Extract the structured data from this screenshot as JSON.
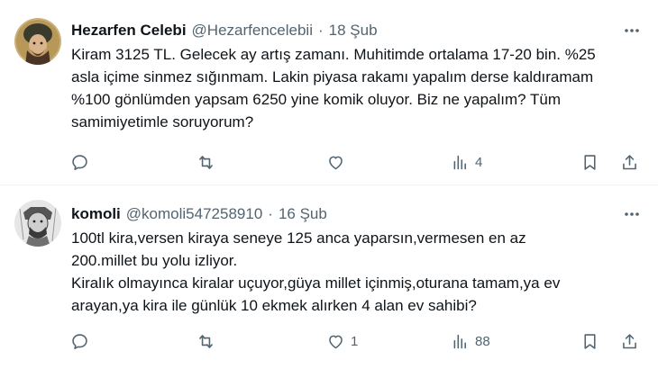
{
  "tweets": [
    {
      "author_name": "Hezarfen Celebi",
      "handle": "@Hezarfencelebii",
      "separator": "·",
      "date": "18 Şub",
      "text_lines": [
        "Kiram 3125 TL. Gelecek ay artış zamanı. Muhitimde ortalama 17-20 bin. %25",
        "asla içime sinmez sığınmam. Lakin piyasa rakamı yapalım derse kaldıramam",
        "%100 gönlümden yapsam 6250 yine komik oluyor. Biz ne yapalım? Tüm",
        "samimiyetimle soruyorum?"
      ],
      "actions": {
        "replies": "",
        "retweets": "",
        "likes": "",
        "views": "4"
      }
    },
    {
      "author_name": "komoli",
      "handle": "@komoli547258910",
      "separator": "·",
      "date": "16 Şub",
      "text_lines": [
        "100tl kira,versen kiraya seneye 125 anca yaparsın,vermesen en az",
        "200.millet bu yolu izliyor.",
        "Kiralık olmayınca kiralar uçuyor,güya millet içinmiş,oturana tamam,ya ev",
        "arayan,ya kira ile günlük 10 ekmek alırken 4 alan ev sahibi?"
      ],
      "actions": {
        "replies": "",
        "retweets": "",
        "likes": "1",
        "views": "88"
      }
    }
  ],
  "icons": {
    "reply": "reply-icon",
    "retweet": "retweet-icon",
    "like": "heart-icon",
    "views": "analytics-icon",
    "bookmark": "bookmark-icon",
    "share": "share-icon",
    "more": "more-dots-icon"
  },
  "colors": {
    "text": "#0f1419",
    "secondary": "#536471",
    "divider": "#eff3f4"
  }
}
